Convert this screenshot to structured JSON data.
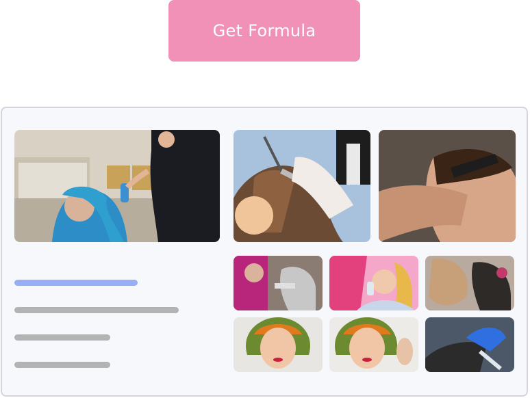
{
  "cta": {
    "label": "Get Formula"
  },
  "colors": {
    "cta_background": "#f291b8",
    "accent_line": "#97aff7",
    "placeholder_line": "#b3b3b3",
    "card_background": "#f7f8fc",
    "card_border": "#d4d4db"
  },
  "gallery": {
    "photos": [
      "stylist-spraying-blue-dreadlocks",
      "foil-highlight-application",
      "hair-clip-styling",
      "stylist-applying-dye",
      "client-with-spray-bottle",
      "curling-long-hair",
      "client-orange-green-bob-1",
      "client-orange-green-bob-2",
      "gloved-hands-coloring"
    ]
  }
}
